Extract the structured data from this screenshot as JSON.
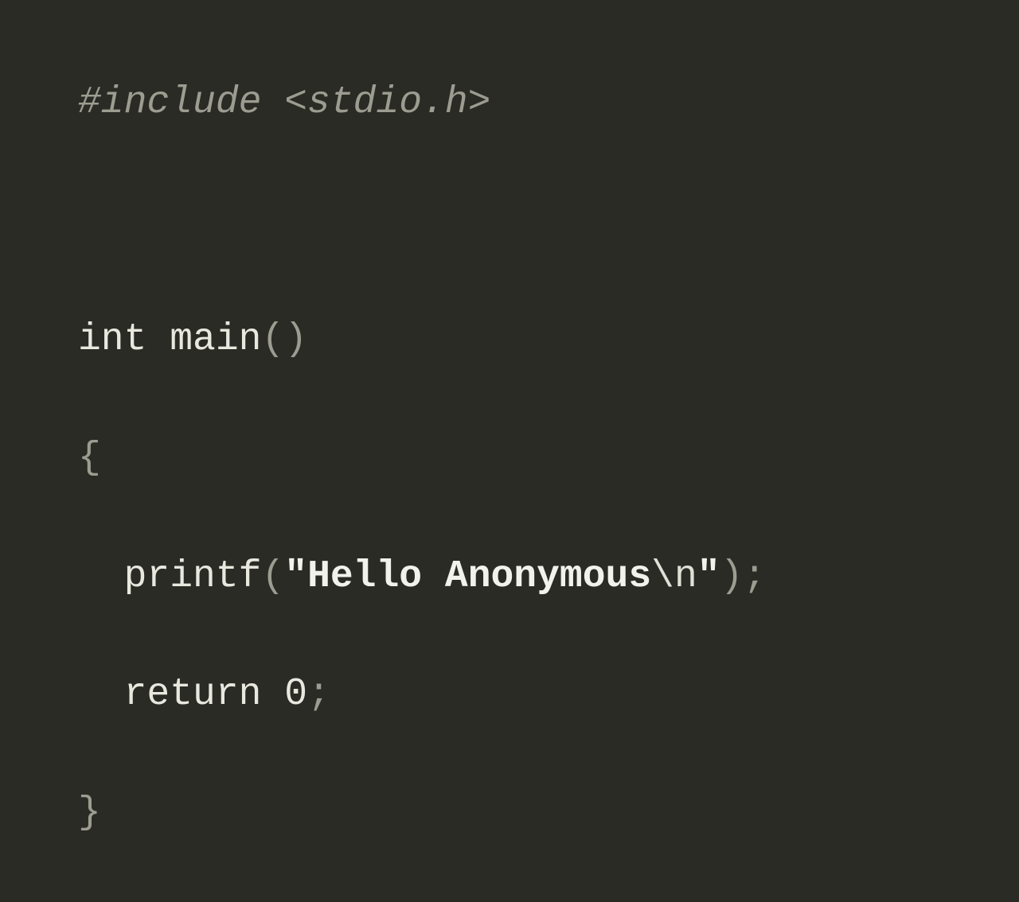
{
  "code": {
    "line1": {
      "preprocessor": "#include <stdio.h>"
    },
    "line3": {
      "kw_int": "int",
      "space1": " ",
      "ident_main": "main",
      "parens": "()"
    },
    "line4": {
      "brace_open": "{"
    },
    "line5": {
      "ident_printf": "printf",
      "paren_open": "(",
      "string_q1": "\"",
      "string_text": "Hello Anonymous",
      "string_escape": "\\n",
      "string_q2": "\"",
      "paren_close": ")",
      "semi": ";"
    },
    "line6": {
      "kw_return": "return",
      "space": " ",
      "zero": "0",
      "semi": ";"
    },
    "line7": {
      "brace_close": "}"
    }
  }
}
